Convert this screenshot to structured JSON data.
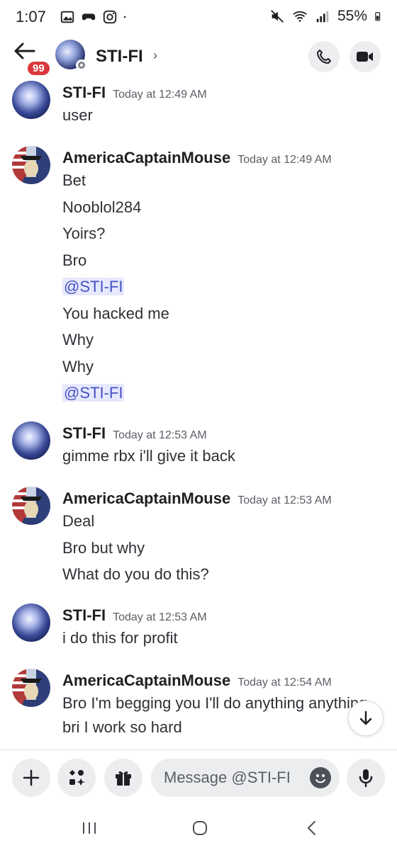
{
  "status_bar": {
    "time": "1:07",
    "battery": "55%"
  },
  "header": {
    "badge": "99",
    "title": "STI-FI",
    "chevron": "›"
  },
  "messages": [
    {
      "author": "STI-FI",
      "timestamp": "Today at 12:49 AM",
      "lines": [
        "user"
      ]
    },
    {
      "author": "AmericaCaptainMouse",
      "timestamp": "Today at 12:49 AM",
      "lines": [
        "Bet",
        "Nooblol284",
        "Yoirs?",
        "Bro",
        "@STI-FI",
        "You hacked me",
        "Why",
        "Why",
        "@STI-FI"
      ]
    },
    {
      "author": "STI-FI",
      "timestamp": "Today at 12:53 AM",
      "lines": [
        "gimme rbx i'll give it back"
      ]
    },
    {
      "author": "AmericaCaptainMouse",
      "timestamp": "Today at 12:53 AM",
      "lines": [
        "Deal",
        "Bro but why",
        "What do you do this?"
      ]
    },
    {
      "author": "STI-FI",
      "timestamp": "Today at 12:53 AM",
      "lines": [
        "i do this for profit"
      ]
    },
    {
      "author": "AmericaCaptainMouse",
      "timestamp": "Today at 12:54 AM",
      "lines": [
        "Bro I'm begging you I'll do anything anything",
        "bri I work so hard"
      ]
    }
  ],
  "composer": {
    "placeholder": "Message @STI-FI"
  },
  "icons": {
    "back": "arrow-left-icon",
    "call": "phone-icon",
    "video": "video-camera-icon",
    "add": "plus-icon",
    "apps": "apps-icon",
    "gift": "gift-icon",
    "emoji": "emoji-icon",
    "mic": "microphone-icon",
    "scroll_down": "arrow-down-icon"
  },
  "colors": {
    "mention_bg": "#e6e8fd",
    "mention_text": "#4752c4",
    "badge": "#da373c"
  }
}
